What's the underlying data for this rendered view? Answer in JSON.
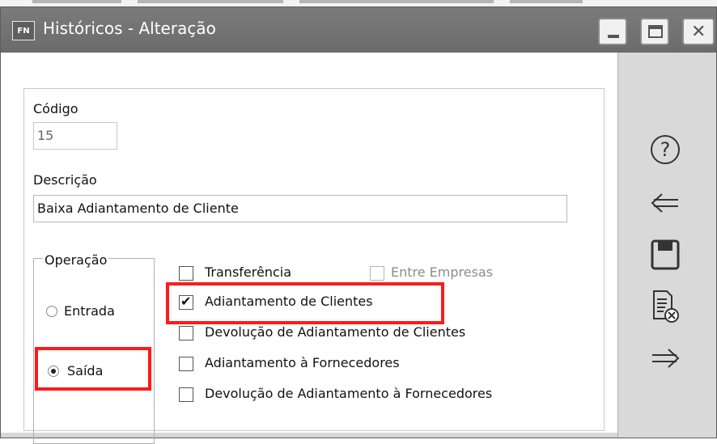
{
  "window": {
    "title": "Históricos - Alteração",
    "app_icon": "FN"
  },
  "form": {
    "codigo_label": "Código",
    "codigo_value": "15",
    "descricao_label": "Descrição",
    "descricao_value": "Baixa Adiantamento de Cliente",
    "operacao": {
      "legend": "Operação",
      "options": [
        {
          "label": "Entrada",
          "selected": false
        },
        {
          "label": "Saída",
          "selected": true
        }
      ]
    },
    "checkboxes": [
      {
        "label": "Transferência",
        "checked": false,
        "enabled": true
      },
      {
        "label": "Entre Empresas",
        "checked": false,
        "enabled": false
      },
      {
        "label": "Adiantamento de Clientes",
        "checked": true,
        "enabled": true
      },
      {
        "label": "Devolução de Adiantamento de Clientes",
        "checked": false,
        "enabled": true
      },
      {
        "label": "Adiantamento à Fornecedores",
        "checked": false,
        "enabled": true
      },
      {
        "label": "Devolução de Adiantamento à Fornecedores",
        "checked": false,
        "enabled": true
      }
    ]
  },
  "side_toolbar": {
    "icons": [
      "help-icon",
      "back-arrow-icon",
      "save-icon",
      "cancel-document-icon",
      "forward-arrow-icon"
    ]
  },
  "colors": {
    "highlight": "#ff1a1a",
    "titlebar": "#707070"
  }
}
